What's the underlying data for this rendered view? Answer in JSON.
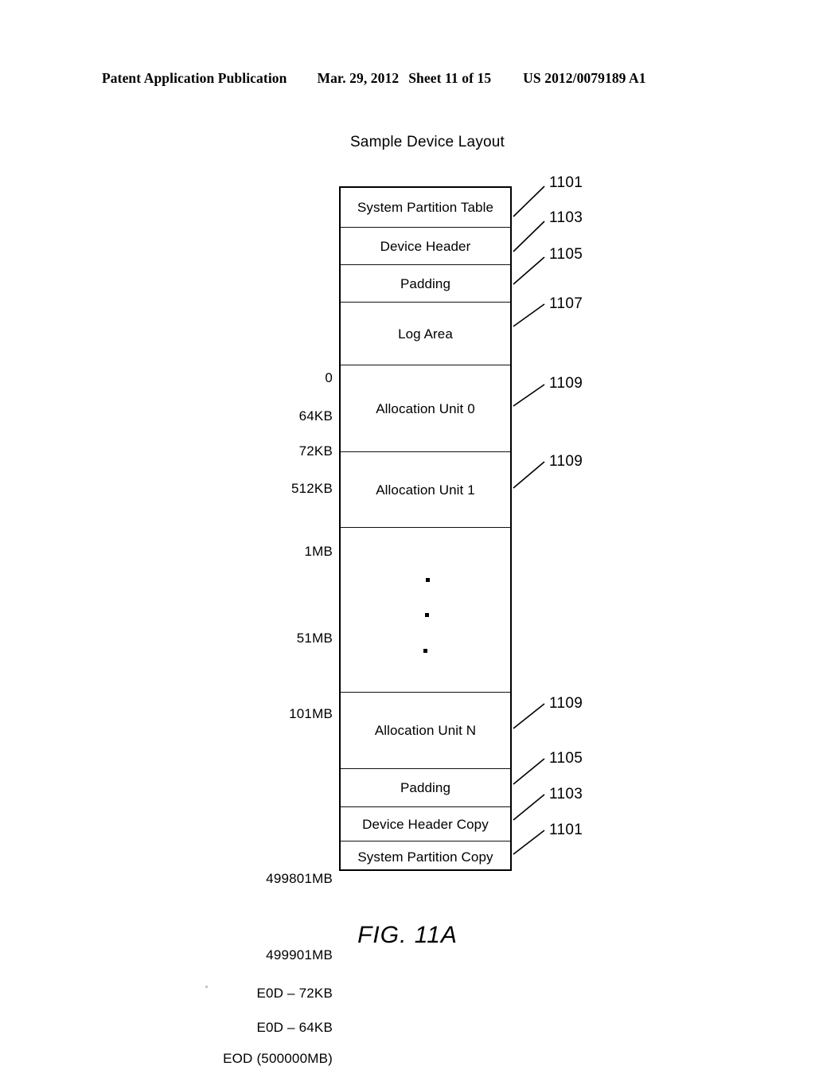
{
  "header": {
    "publication": "Patent Application Publication",
    "date": "Mar. 29, 2012",
    "sheet": "Sheet 11 of 15",
    "number": "US 2012/0079189 A1"
  },
  "figure": {
    "title": "Sample Device Layout",
    "caption": "FIG. 11A",
    "ellipsis_glyph": "vertical-ellipsis",
    "line_color": "#000000",
    "bands": [
      {
        "label": "System Partition Table",
        "start_offset": "0",
        "ref": "1101"
      },
      {
        "label": "Device Header",
        "start_offset": "64KB",
        "ref": "1103"
      },
      {
        "label": "Padding",
        "start_offset": "72KB",
        "ref": "1105"
      },
      {
        "label": "Log Area",
        "start_offset": "512KB",
        "ref": "1107"
      },
      {
        "label": "Allocation Unit 0",
        "start_offset": "1MB",
        "ref": "1109"
      },
      {
        "label": "Allocation Unit 1",
        "start_offset": "51MB",
        "ref": "1109"
      },
      {
        "label": "",
        "start_offset": "101MB",
        "ref": ""
      },
      {
        "label": "Allocation Unit N",
        "start_offset": "499801MB",
        "ref": "1109"
      },
      {
        "label": "Padding",
        "start_offset": "499901MB",
        "ref": "1105"
      },
      {
        "label": "Device Header Copy",
        "start_offset": "E0D – 72KB",
        "ref": "1103"
      },
      {
        "label": "System Partition Copy",
        "start_offset": "E0D – 64KB",
        "ref": "1101"
      }
    ],
    "end_offset": "EOD (500000MB)",
    "reference_numerals": [
      "1101",
      "1103",
      "1105",
      "1107",
      "1109",
      "1109",
      "1109",
      "1105",
      "1103",
      "1101"
    ]
  }
}
